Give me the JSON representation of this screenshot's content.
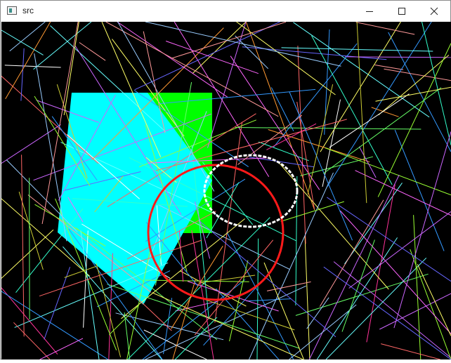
{
  "window": {
    "title": "src",
    "icon": "app-window-icon",
    "controls": [
      "minimize-icon",
      "maximize-icon",
      "close-icon"
    ],
    "canvas_background": "#000000"
  },
  "colors": {
    "polygon_cyan": "#00ffff",
    "polygon_green": "#00ff00",
    "ellipse_white": "#ffffff",
    "circle_red": "#ff1a1a"
  }
}
